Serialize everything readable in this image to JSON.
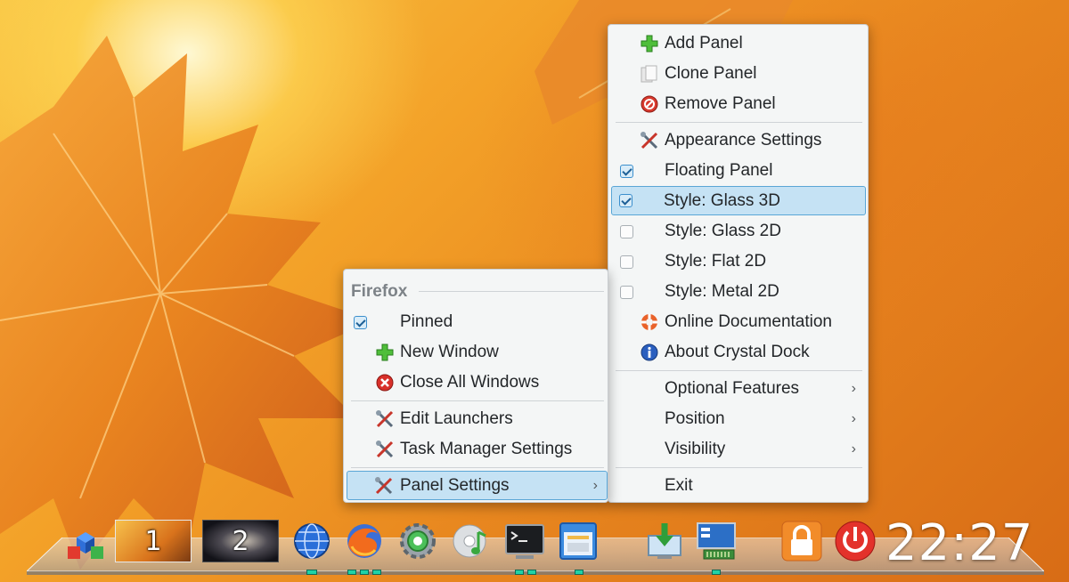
{
  "panel_menu": {
    "items": [
      {
        "label": "Add Panel",
        "icon": "add-icon"
      },
      {
        "label": "Clone Panel",
        "icon": "clone-icon"
      },
      {
        "label": "Remove Panel",
        "icon": "remove-icon"
      },
      {
        "label": "Appearance Settings",
        "icon": "tools-icon"
      },
      {
        "label": "Floating Panel",
        "checked": true
      },
      {
        "label": "Style: Glass 3D",
        "checked": true,
        "highlighted": true
      },
      {
        "label": "Style: Glass 2D",
        "checked": false
      },
      {
        "label": "Style: Flat 2D",
        "checked": false
      },
      {
        "label": "Style: Metal 2D",
        "checked": false
      },
      {
        "label": "Online Documentation",
        "icon": "lifebuoy-icon"
      },
      {
        "label": "About Crystal Dock",
        "icon": "info-icon"
      },
      {
        "label": "Optional Features",
        "submenu": true
      },
      {
        "label": "Position",
        "submenu": true
      },
      {
        "label": "Visibility",
        "submenu": true
      },
      {
        "label": "Exit"
      }
    ]
  },
  "app_menu": {
    "title": "Firefox",
    "items": [
      {
        "label": "Pinned",
        "checked": true
      },
      {
        "label": "New Window",
        "icon": "add-icon"
      },
      {
        "label": "Close All Windows",
        "icon": "close-icon"
      },
      {
        "label": "Edit Launchers",
        "icon": "tools-icon"
      },
      {
        "label": "Task Manager Settings",
        "icon": "tools-icon"
      },
      {
        "label": "Panel Settings",
        "icon": "tools-icon",
        "submenu": true,
        "highlighted": true
      }
    ]
  },
  "dock": {
    "desktops": [
      {
        "label": "1"
      },
      {
        "label": "2"
      }
    ],
    "launchers": [
      "application-menu-icon",
      "browser-globe-icon",
      "firefox-icon",
      "settings-gear-icon",
      "music-player-icon",
      "terminal-icon",
      "file-manager-icon",
      "software-install-icon",
      "system-monitor-icon",
      "lock-screen-icon",
      "power-icon"
    ],
    "clock": "22:27"
  },
  "colors": {
    "highlight": "#c5e2f4",
    "indicator": "#1fd2a6",
    "menu_bg": "#f4f6f6"
  }
}
